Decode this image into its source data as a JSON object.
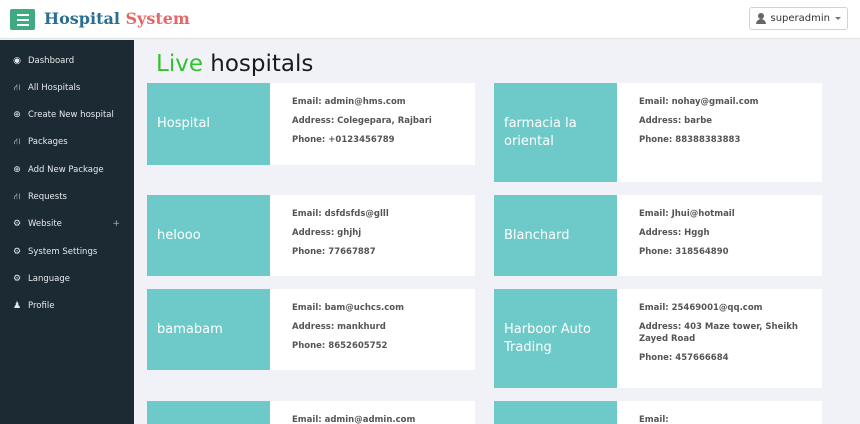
{
  "header": {
    "brand_part1": "Hospital",
    "brand_part2": "System",
    "user_label": "superadmin"
  },
  "sidebar": {
    "items": [
      {
        "label": "Dashboard",
        "icon": "dashboard-icon"
      },
      {
        "label": "All Hospitals",
        "icon": "sitemap-icon"
      },
      {
        "label": "Create New hospital",
        "icon": "plus-circle-icon"
      },
      {
        "label": "Packages",
        "icon": "sitemap-icon"
      },
      {
        "label": "Add New Package",
        "icon": "plus-circle-icon"
      },
      {
        "label": "Requests",
        "icon": "sitemap-icon"
      },
      {
        "label": "Website",
        "icon": "gears-icon"
      },
      {
        "label": "System Settings",
        "icon": "gear-icon"
      },
      {
        "label": "Language",
        "icon": "gear-icon"
      },
      {
        "label": "Profile",
        "icon": "user-icon"
      }
    ],
    "website_expand": "+"
  },
  "main": {
    "title_live": "Live",
    "title_rest": "hospitals"
  },
  "cards": [
    {
      "name": "Hospital",
      "email": "Email: admin@hms.com",
      "address": "Address: Colegepara, Rajbari",
      "phone": "Phone: +0123456789"
    },
    {
      "name": "farmacia la oriental",
      "email": "Email: nohay@gmail.com",
      "address": "Address: barbe",
      "phone": "Phone: 88388383883"
    },
    {
      "name": "helooo",
      "email": "Email: dsfdsfds@glll",
      "address": "Address: ghjhj",
      "phone": "Phone: 77667887"
    },
    {
      "name": "Blanchard",
      "email": "Email: Jhui@hotmail",
      "address": "Address: Hggh",
      "phone": "Phone: 318564890"
    },
    {
      "name": "bamabam",
      "email": "Email: bam@uchcs.com",
      "address": "Address: mankhurd",
      "phone": "Phone: 8652605752"
    },
    {
      "name": "Harboor Auto Trading",
      "email": "Email: 25469001@qq.com",
      "address": "Address: 403 Maze tower, Sheikh Zayed Road",
      "phone": "Phone: 457666684"
    },
    {
      "name": "",
      "email": "Email: admin@admin.com",
      "address": "",
      "phone": ""
    },
    {
      "name": "",
      "email": "Email:",
      "address": "",
      "phone": ""
    }
  ]
}
